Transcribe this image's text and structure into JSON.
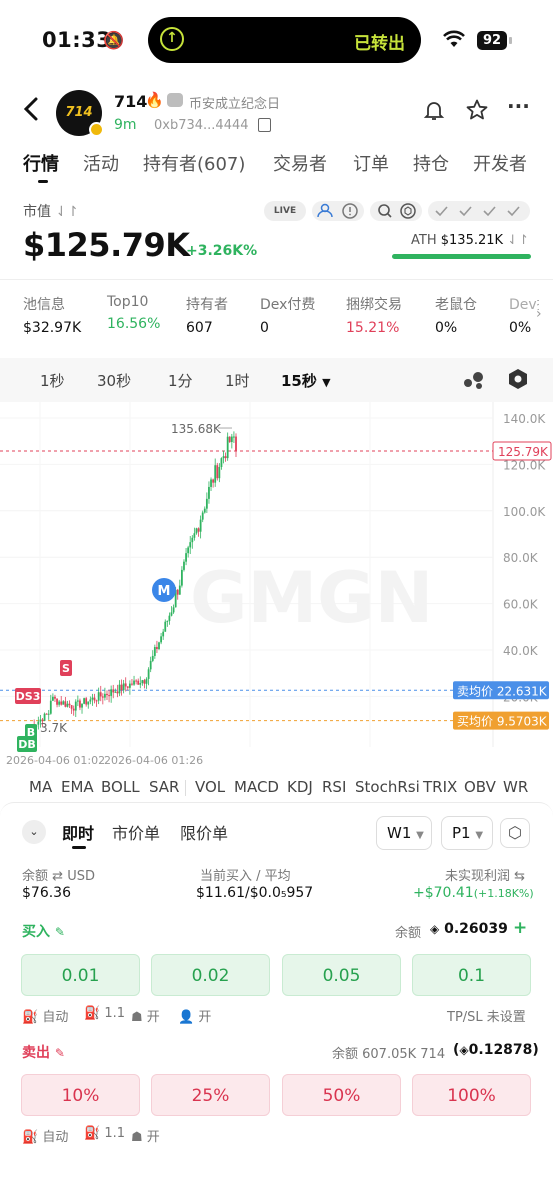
{
  "status_bar": {
    "time": "01:33",
    "island_text": "已转出",
    "battery": "92"
  },
  "token": {
    "name": "714",
    "avatar_text": "714",
    "subtitle": "币安成立纪念日",
    "age": "9m",
    "address": "0xb734...4444"
  },
  "tabs": [
    "行情",
    "活动",
    "持有者(607)",
    "交易者",
    "订单",
    "持仓",
    "开发者"
  ],
  "market": {
    "label": "市值",
    "value": "$125.79K",
    "change": "+3.26K%",
    "live": "LIVE",
    "ath_label": "ATH",
    "ath_value": "$135.21K"
  },
  "stats": [
    {
      "label": "池信息",
      "value": "$32.97K",
      "color": "#111111"
    },
    {
      "label": "Top10",
      "value": "16.56%",
      "color": "#2fb35f"
    },
    {
      "label": "持有者",
      "value": "607",
      "color": "#111111"
    },
    {
      "label": "Dex付费",
      "value": "0",
      "color": "#111111"
    },
    {
      "label": "捆绑交易",
      "value": "15.21%",
      "color": "#e0405a"
    },
    {
      "label": "老鼠仓",
      "value": "0%",
      "color": "#111111"
    },
    {
      "label": "Dev持",
      "value": "0%",
      "color": "#111111"
    }
  ],
  "intervals": [
    "1秒",
    "30秒",
    "1分",
    "1时",
    "15秒"
  ],
  "active_interval": "15秒",
  "chart": {
    "y_ticks": [
      "140.0K",
      "120.0K",
      "100.0K",
      "80.0K",
      "60.0K",
      "40.0K",
      "20.0K"
    ],
    "current_price": "125.79K",
    "peak_label": "135.68K",
    "low_label": "3.7K",
    "x_ticks": [
      "2026-04-06 01:02",
      "2026-04-06 01:26"
    ],
    "sell_avg_label": "卖均价",
    "sell_avg": "22.631K",
    "buy_avg_label": "买均价",
    "buy_avg": "9.5703K",
    "markers": [
      "S",
      "DS3",
      "B",
      "DB",
      "M"
    ],
    "watermark": "GMGN"
  },
  "indicators": [
    "MA",
    "EMA",
    "BOLL",
    "SAR",
    "VOL",
    "MACD",
    "KDJ",
    "RSI",
    "StochRsi",
    "TRIX",
    "OBV",
    "WR"
  ],
  "order": {
    "tabs": [
      "即时",
      "市价单",
      "限价单"
    ],
    "wallet": "W1",
    "preset": "P1",
    "balance_label": "余额",
    "balance_unit": "USD",
    "balance_value": "$76.36",
    "buy_avg_label": "当前买入 / 平均",
    "buy_avg_value": "$11.61/$0.0₅957",
    "pnl_label": "未实现利润",
    "pnl_value": "+$70.41",
    "pnl_pct": "(+1.18K%)",
    "buy_label": "买入",
    "buy_balance_label": "余额",
    "buy_balance_value": "0.26039",
    "buy_buttons": [
      "0.01",
      "0.02",
      "0.05",
      "0.1"
    ],
    "buy_options": [
      "自动",
      "1.1",
      "开",
      "开"
    ],
    "tpsl": "TP/SL 未设置",
    "sell_label": "卖出",
    "sell_balance_text": "余额 607.05K 714",
    "sell_balance_value": "0.12878",
    "sell_buttons": [
      "10%",
      "25%",
      "50%",
      "100%"
    ],
    "sell_options": [
      "自动",
      "1.1",
      "开"
    ]
  }
}
